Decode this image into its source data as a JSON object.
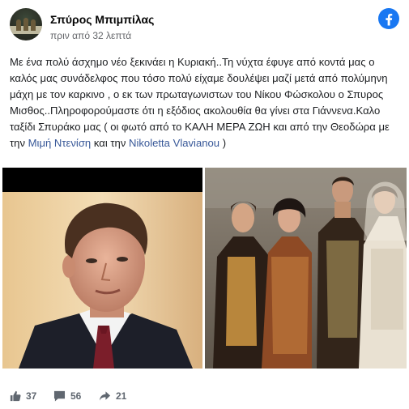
{
  "post": {
    "author": "Σπύρος Μπιμπίλας",
    "timestamp": "πριν από 32 λεπτά",
    "text_main": "Με ένα πολύ άσχημο νέο ξεκινάει η Κυριακή..Τη νύχτα έφυγε από κοντά μας ο καλός μας συνάδελφος που τόσο πολύ είχαμε δουλέψει μαζί μετά από πολύμηνη μάχη με τον καρκινο , ο εκ των πρωταγωνιστων του Νίκου Φώσκολου ο Σπυρος Μισθος..Πληροφορούμαστε ότι η εξόδιος ακολουθία θα γίνει στα Γιάννενα.Καλο ταξίδι Σπυράκο μας ( οι φωτό από το ΚΑΛΗ ΜΕΡΑ ΖΩΗ και από την Θεοδώρα με την ",
    "mention_1": "Μιμή Ντενίση",
    "text_and": " και την ",
    "mention_2": "Nikoletta Vlavianou",
    "text_end": " )"
  },
  "photos": [
    {
      "name": "portrait-photo"
    },
    {
      "name": "group-costume-photo"
    }
  ],
  "stats": {
    "likes": "37",
    "comments": "56",
    "shares": "21"
  },
  "colors": {
    "facebook_blue": "#1877f2",
    "link": "#385898",
    "muted": "#606770"
  },
  "icons": [
    "facebook-logo-icon",
    "like-icon",
    "comment-icon",
    "share-icon"
  ]
}
